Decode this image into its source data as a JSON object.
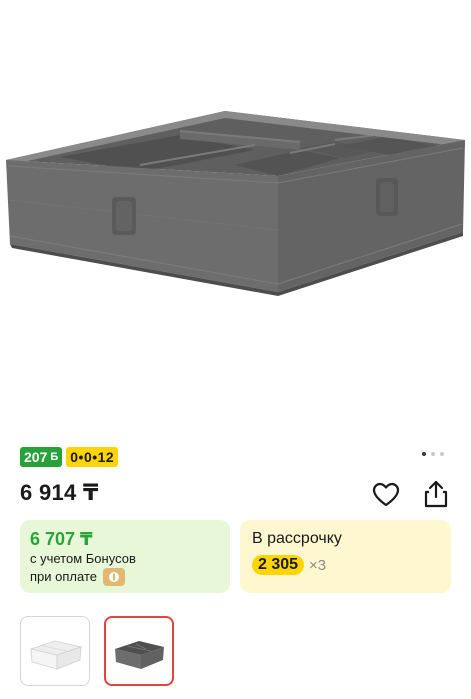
{
  "product": {
    "image_alt": "Dark gray fabric box with compartments",
    "bonus_badge": "207",
    "bonus_symbol": "Б",
    "installment_badge": "0•0•12",
    "price": "6 914 ₸",
    "gallery_dots": 3,
    "gallery_active_index": 0
  },
  "bonus_card": {
    "price": "6 707 ₸",
    "line1": "с учетом Бонусов",
    "line2": "при оплате"
  },
  "installment_card": {
    "title": "В рассрочку",
    "amount": "2 305",
    "multiplier": "×3"
  },
  "thumbnails": [
    {
      "variant": "white",
      "selected": false
    },
    {
      "variant": "dark gray",
      "selected": true
    }
  ],
  "icons": {
    "favorite": "heart-icon",
    "share": "share-icon"
  },
  "colors": {
    "bonus_green": "#28a13b",
    "installment_yellow": "#ffd400",
    "selected_thumb_border": "#e2463a",
    "product_gray": "#707070"
  }
}
